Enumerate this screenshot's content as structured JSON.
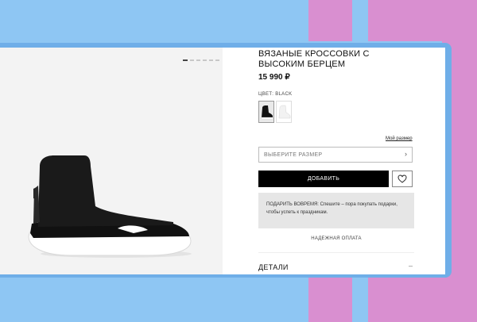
{
  "product": {
    "title": "ВЯЗАНЫЕ КРОССОВКИ С ВЫСОКИМ БЕРЦЕМ",
    "price": "15 990 ₽",
    "color_label": "ЦВЕТ: BLACK",
    "size_guide": "Мой размер",
    "size_placeholder": "ВЫБЕРИТЕ РАЗМЕР",
    "add_button": "ДОБАВИТЬ",
    "promo_text": "ПОДАРИТЬ ВОВРЕМЯ: Спешите – пора покупать подарки, чтобы успеть к праздникам.",
    "payment_label": "НАДЕЖНАЯ ОПЛАТА",
    "details_label": "ДЕТАЛИ"
  },
  "gallery": {
    "slides": 6,
    "active_slide": 1
  },
  "icons": [
    "chevron-right-icon",
    "heart-icon",
    "minus-icon"
  ],
  "colors": {
    "accent": "#000000",
    "background_blue": "#8ec6f3",
    "background_pink": "#d98fd0",
    "promo_bg": "#e6e6e6"
  }
}
